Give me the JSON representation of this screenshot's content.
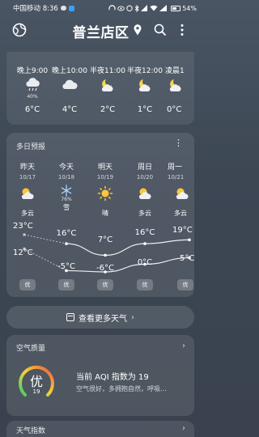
{
  "status_bar": {
    "carrier_time": "中国移动 8:36",
    "battery": "54%"
  },
  "header": {
    "city": "普兰店区",
    "icons": [
      "globe-icon",
      "location-pin-icon",
      "search-icon",
      "more-vertical-icon"
    ]
  },
  "hourly": [
    {
      "time": "晚上9:00",
      "icon": "rain-icon",
      "pop": "40%",
      "temp": "6°C"
    },
    {
      "time": "晚上10:00",
      "icon": "cloudy-icon",
      "pop": "",
      "temp": "4°C"
    },
    {
      "time": "半夜11:00",
      "icon": "partly-cloudy-night-icon",
      "pop": "",
      "temp": "2°C"
    },
    {
      "time": "半夜12:00",
      "icon": "partly-cloudy-night-icon",
      "pop": "",
      "temp": "1°C"
    },
    {
      "time": "凌晨1",
      "icon": "partly-cloudy-night-icon",
      "pop": "",
      "temp": "0°C"
    }
  ],
  "daily_forecast": {
    "title": "多日预报",
    "days": [
      {
        "name": "昨天",
        "date": "10/17",
        "icon": "partly-cloudy-icon",
        "pop": "",
        "condition": "多云",
        "high": "23°C",
        "low": "12°C",
        "high_value": 23,
        "low_value": 12,
        "aqi": "优"
      },
      {
        "name": "今天",
        "date": "10/18",
        "icon": "snow-icon",
        "pop": "76%",
        "condition": "雪",
        "high": "16°C",
        "low": "-5°C",
        "high_value": 16,
        "low_value": -5,
        "aqi": "优"
      },
      {
        "name": "明天",
        "date": "10/19",
        "icon": "sunny-icon",
        "pop": "",
        "condition": "晴",
        "high": "7°C",
        "low": "-6°C",
        "high_value": 7,
        "low_value": -6,
        "aqi": "优"
      },
      {
        "name": "周日",
        "date": "10/20",
        "icon": "partly-cloudy-icon",
        "pop": "",
        "condition": "多云",
        "high": "16°C",
        "low": "0°C",
        "high_value": 16,
        "low_value": 0,
        "aqi": "优"
      },
      {
        "name": "周一",
        "date": "10/21",
        "icon": "partly-cloudy-icon",
        "pop": "",
        "condition": "多云",
        "high": "19°C",
        "low": "5°C",
        "high_value": 19,
        "low_value": 5,
        "aqi": "优"
      }
    ]
  },
  "more_button": {
    "label": "查看更多天气",
    "chevron": "›"
  },
  "air_quality": {
    "title": "空气质量",
    "level": "优",
    "index": "19",
    "headline": "当前 AQI 指数为 19",
    "description": "空气很好，多拥抱自然，呼吸…"
  },
  "life_index": {
    "title": "天气指数"
  },
  "colors": {
    "snow_accent": "#a7d4ff",
    "sun": "#ffc63a",
    "gauge_green": "#3fcf6a",
    "gauge_yellow": "#f6d23b",
    "gauge_red": "#e8455f"
  }
}
